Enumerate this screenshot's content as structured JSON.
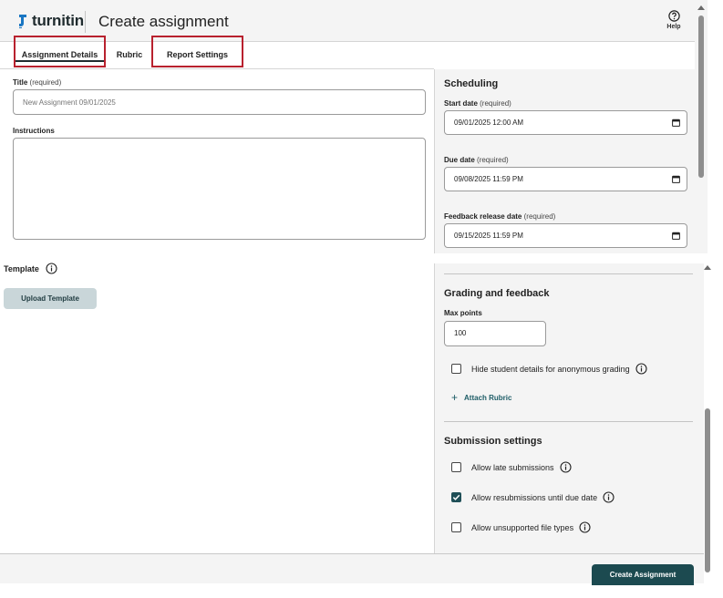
{
  "header": {
    "brand": "turnitin",
    "title": "Create assignment",
    "help_label": "Help"
  },
  "tabs": [
    {
      "label": "Assignment Details",
      "selected": true
    },
    {
      "label": "Rubric",
      "selected": false
    },
    {
      "label": "Report Settings",
      "selected": false
    }
  ],
  "details": {
    "title_label": "Title",
    "title_req": "(required)",
    "title_placeholder": "New Assignment 09/01/2025",
    "instructions_label": "Instructions",
    "template_label": "Template",
    "upload_label": "Upload Template"
  },
  "scheduling": {
    "title": "Scheduling",
    "start_label": "Start date",
    "start_req": "(required)",
    "start_value": "09/01/2025 12:00 AM",
    "due_label": "Due date",
    "due_req": "(required)",
    "due_value": "09/08/2025 11:59 PM",
    "release_label": "Feedback release date",
    "release_req": "(required)",
    "release_value": "09/15/2025 11:59 PM"
  },
  "grading": {
    "title": "Grading and feedback",
    "max_points_label": "Max points",
    "max_points_value": "100",
    "anonymous_label": "Hide student details for anonymous grading",
    "anonymous_checked": false,
    "attach_label": "Attach Rubric"
  },
  "submission": {
    "title": "Submission settings",
    "items": [
      {
        "label": "Allow late submissions",
        "checked": false
      },
      {
        "label": "Allow resubmissions until due date",
        "checked": true
      },
      {
        "label": "Allow unsupported file types",
        "checked": false
      }
    ]
  },
  "footer": {
    "create_label": "Create Assignment"
  },
  "colors": {
    "accent": "#1c4a50",
    "highlight_border": "#b8212e",
    "panel_bg": "#f4f4f4"
  }
}
